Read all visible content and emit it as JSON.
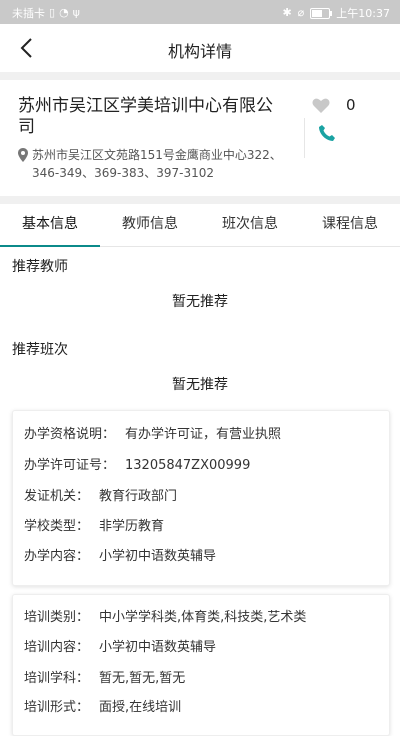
{
  "status_bar": {
    "carrier": "未插卡",
    "time": "上午10:37",
    "battery_level": 0.6
  },
  "header": {
    "title": "机构详情"
  },
  "organization": {
    "name": "苏州市吴江区学美培训中心有限公司",
    "address": "苏州市吴江区文苑路151号金鹰商业中心322、346-349、369-383、397-3102",
    "like_count": "0"
  },
  "tabs": [
    {
      "label": "基本信息",
      "active": true
    },
    {
      "label": "教师信息",
      "active": false
    },
    {
      "label": "班次信息",
      "active": false
    },
    {
      "label": "课程信息",
      "active": false
    }
  ],
  "recommend_teachers": {
    "title": "推荐教师",
    "empty_text": "暂无推荐"
  },
  "recommend_classes": {
    "title": "推荐班次",
    "empty_text": "暂无推荐"
  },
  "license_card": [
    {
      "label": "办学资格说明：",
      "value": "有办学许可证，有营业执照"
    },
    {
      "label": "办学许可证号：",
      "value": "13205847ZX00999"
    },
    {
      "label": "发证机关：",
      "value": "教育行政部门"
    },
    {
      "label": "学校类型：",
      "value": "非学历教育"
    },
    {
      "label": "办学内容：",
      "value": "小学初中语数英辅导"
    }
  ],
  "training_card": [
    {
      "label": "培训类别：",
      "value": "中小学学科类,体育类,科技类,艺术类"
    },
    {
      "label": "培训内容：",
      "value": "小学初中语数英辅导"
    },
    {
      "label": "培训学科：",
      "value": "暂无,暂无,暂无"
    },
    {
      "label": "培训形式：",
      "value": "面授,在线培训"
    }
  ],
  "colors": {
    "accent": "#0b8a8a",
    "status_bar": "#c9c9c9"
  }
}
